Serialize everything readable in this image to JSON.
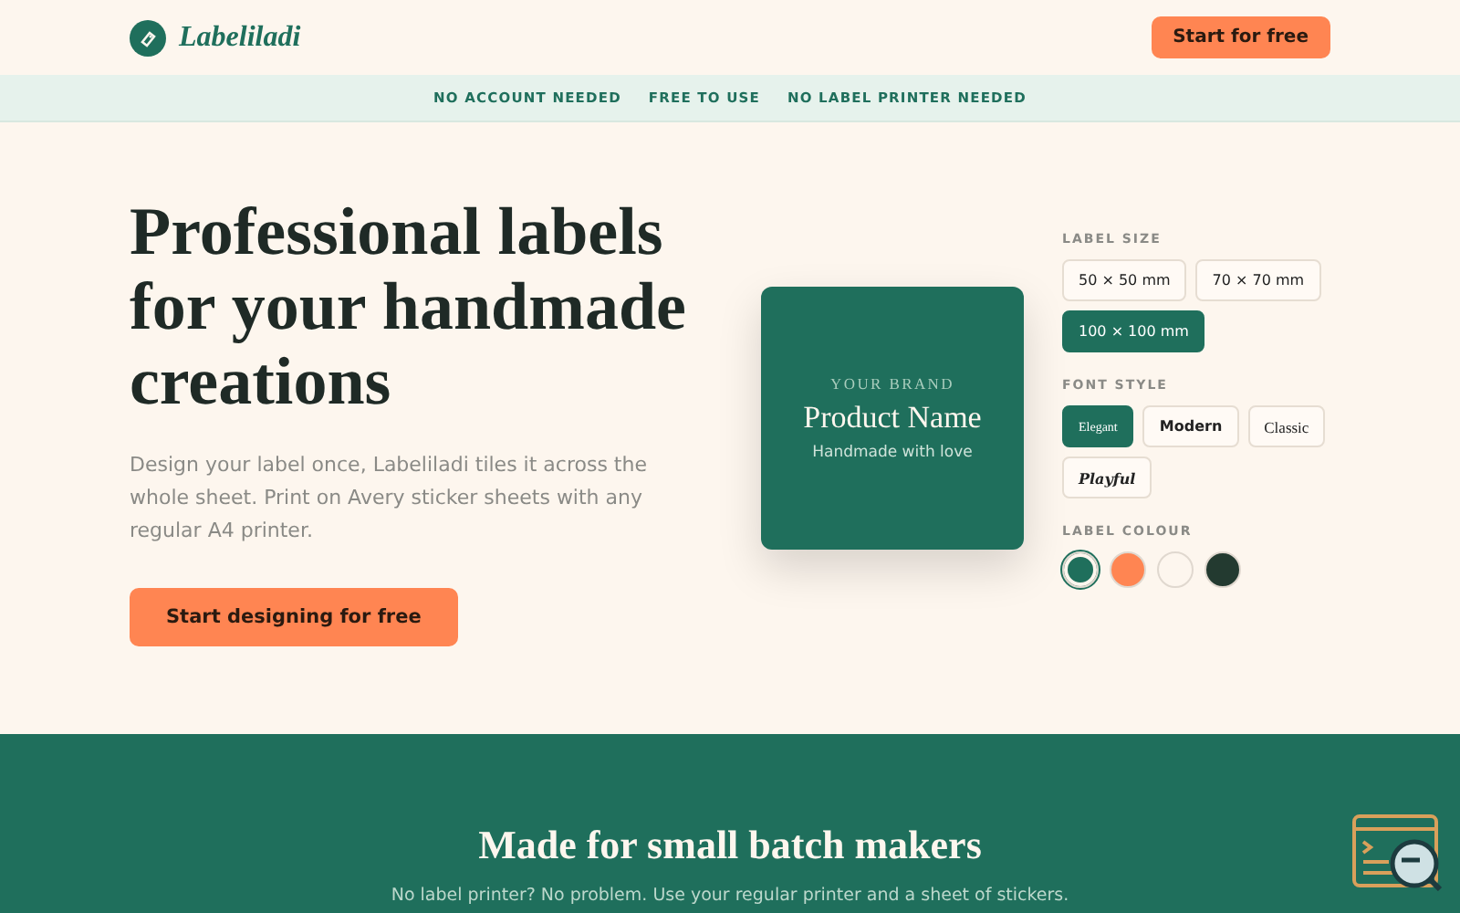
{
  "header": {
    "logo": "Labeliladi",
    "cta": "Start for free"
  },
  "banner": [
    "NO ACCOUNT NEEDED",
    "FREE TO USE",
    "NO LABEL PRINTER NEEDED"
  ],
  "hero": {
    "title_lines": [
      "Professional labels",
      "for your handmade",
      "creations"
    ],
    "description": "Design your label once, Labeliladi tiles it across the whole sheet. Print on Avery sticker sheets with any regular A4 printer.",
    "cta": "Start designing for free"
  },
  "preview": {
    "brand": "YOUR BRAND",
    "product": "Product Name",
    "tagline": "Handmade with love"
  },
  "options": {
    "size_title": "LABEL SIZE",
    "sizes": [
      {
        "label": "50 × 50 mm",
        "selected": false
      },
      {
        "label": "70 × 70 mm",
        "selected": false
      },
      {
        "label": "100 × 100 mm",
        "selected": true
      }
    ],
    "font_title": "FONT STYLE",
    "fonts": [
      {
        "label": "Elegant",
        "kind": "elegant",
        "selected": true
      },
      {
        "label": "Modern",
        "kind": "modern",
        "selected": false
      },
      {
        "label": "Classic",
        "kind": "classic",
        "selected": false
      },
      {
        "label": "Playful",
        "kind": "playful",
        "selected": false
      }
    ],
    "colour_title": "LABEL COLOUR",
    "colours": [
      {
        "color": "#1f6f5c",
        "selected": true
      },
      {
        "color": "#ff8552",
        "selected": false
      },
      {
        "color": "#fdf6ee",
        "selected": false
      },
      {
        "color": "#233a30",
        "selected": false
      }
    ]
  },
  "section": {
    "title": "Made for small batch makers",
    "subtitle": "No label printer? No problem. Use your regular printer and a sheet of stickers."
  }
}
